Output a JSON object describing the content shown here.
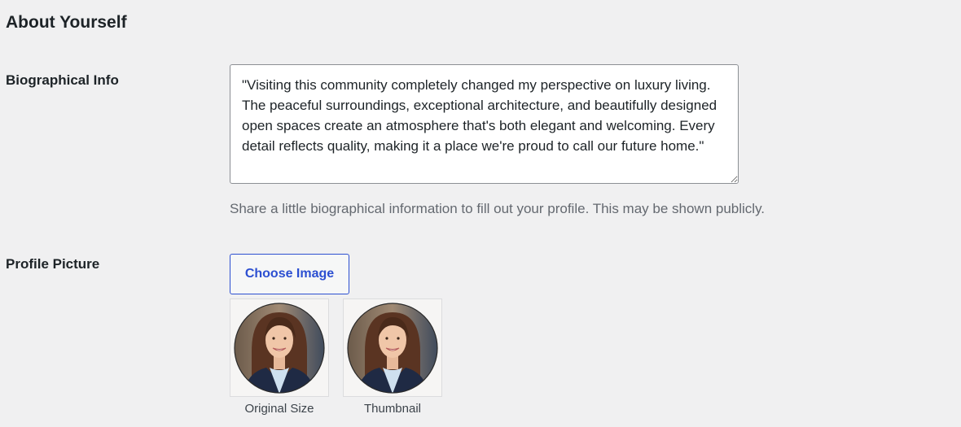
{
  "section": {
    "title": "About Yourself"
  },
  "bio": {
    "label": "Biographical Info",
    "value": "\"Visiting this community completely changed my perspective on luxury living. The peaceful surroundings, exceptional architecture, and beautifully designed open spaces create an atmosphere that's both elegant and welcoming. Every detail reflects quality, making it a place we're proud to call our future home.\"",
    "description": "Share a little biographical information to fill out your profile. This may be shown publicly."
  },
  "profile_picture": {
    "label": "Profile Picture",
    "choose_button": "Choose Image",
    "previews": [
      {
        "caption": "Original Size"
      },
      {
        "caption": "Thumbnail"
      }
    ]
  },
  "colors": {
    "page_bg": "#f0f0f1",
    "accent": "#2c4fd1",
    "muted_text": "#646970"
  }
}
